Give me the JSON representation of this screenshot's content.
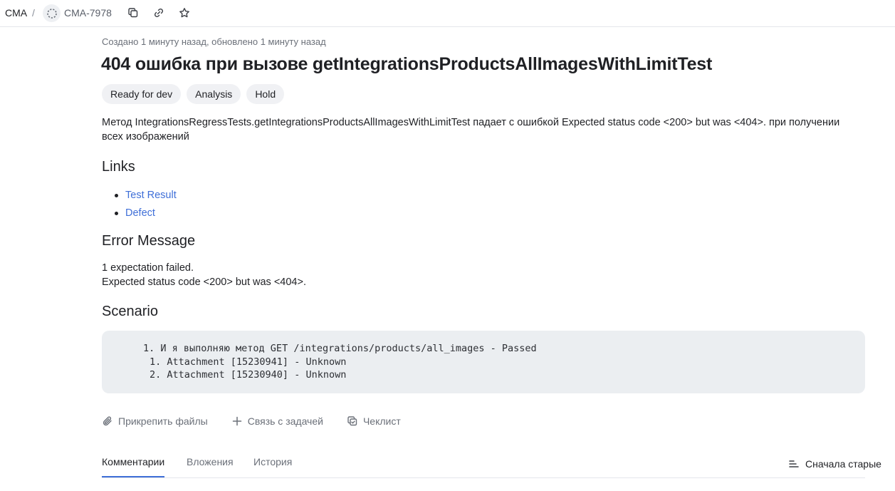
{
  "header": {
    "queue": "CMA",
    "separator": "/",
    "issue_key": "CMA-7978"
  },
  "issue": {
    "meta": "Создано 1 минуту назад, обновлено 1 минуту назад",
    "title": "404 ошибка при вызове getIntegrationsProductsAllImagesWithLimitTest",
    "chips": [
      "Ready for dev",
      "Analysis",
      "Hold"
    ],
    "description": "Метод IntegrationsRegressTests.getIntegrationsProductsAllImagesWithLimitTest падает с ошибкой Expected status code <200> but was <404>. при получении всех изображений",
    "links_heading": "Links",
    "links": [
      "Test Result",
      "Defect"
    ],
    "error_heading": "Error Message",
    "error_lines": [
      "1 expectation failed.",
      "Expected status code <200> but was <404>."
    ],
    "scenario_heading": "Scenario",
    "scenario_lines": [
      "1. И я выполняю метод GET /integrations/products/all_images - Passed",
      "1. Attachment [15230941] - Unknown",
      "2. Attachment [15230940] - Unknown"
    ]
  },
  "actions": {
    "attach": "Прикрепить файлы",
    "link": "Связь с задачей",
    "checklist": "Чеклист"
  },
  "tabs": {
    "comments": "Комментарии",
    "attachments": "Вложения",
    "history": "История",
    "sort": "Сначала старые"
  },
  "colors": {
    "accent": "#3f6fd8",
    "chip_bg": "#f0f1f4",
    "code_bg": "#ebeef1"
  }
}
